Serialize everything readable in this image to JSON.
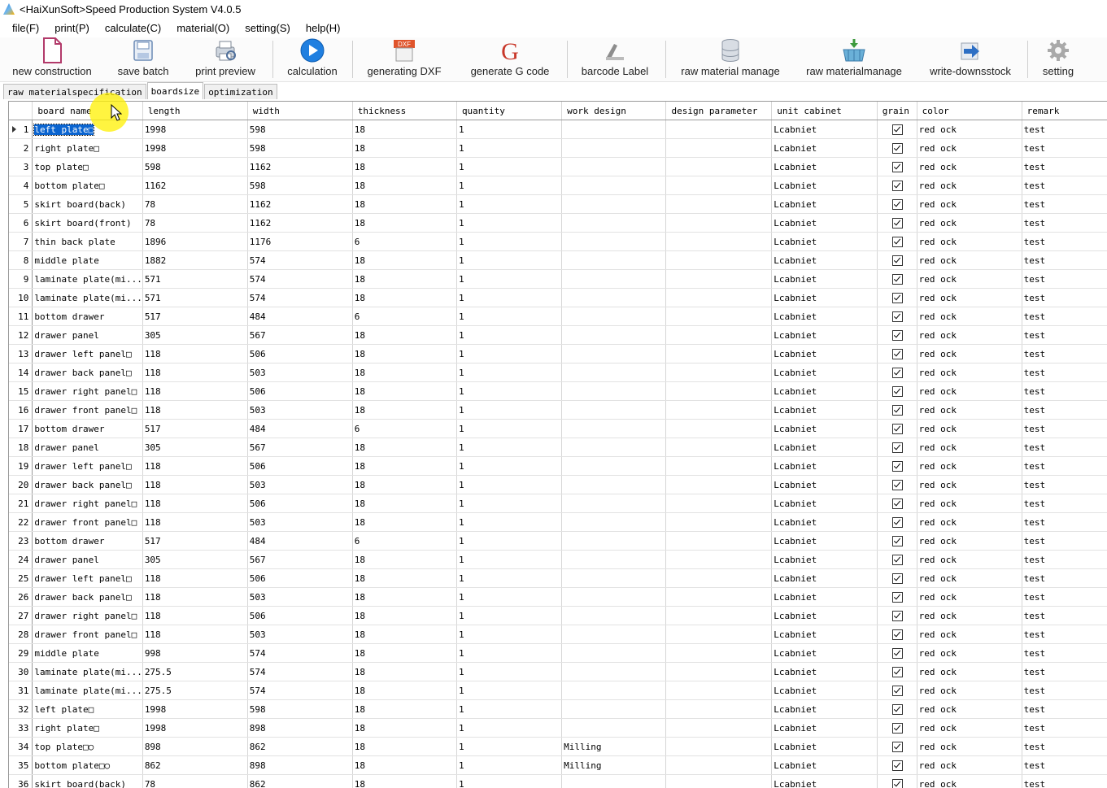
{
  "window": {
    "title": "<HaiXunSoft>Speed Production System V4.0.5"
  },
  "menu": [
    "file(F)",
    "print(P)",
    "calculate(C)",
    "material(O)",
    "setting(S)",
    "help(H)"
  ],
  "toolbar": [
    {
      "label": "new construction",
      "icon": "document-icon"
    },
    {
      "label": "save batch",
      "icon": "save-icon"
    },
    {
      "label": "print preview",
      "icon": "print-preview-icon"
    },
    {
      "label": "calculation",
      "icon": "play-icon"
    },
    {
      "label": "generating DXF",
      "icon": "dxf-icon"
    },
    {
      "label": "generate G code",
      "icon": "g-code-icon"
    },
    {
      "label": "barcode Label",
      "icon": "barcode-icon"
    },
    {
      "label": "raw material manage",
      "icon": "database-icon"
    },
    {
      "label": "raw materialmanage",
      "icon": "basket-icon"
    },
    {
      "label": "write-downsstock",
      "icon": "arrow-right-icon"
    },
    {
      "label": "setting",
      "icon": "gear-icon"
    }
  ],
  "tabs": [
    "raw materialspecification",
    "boardsize",
    "optimization"
  ],
  "active_tab": 1,
  "columns": [
    "board name",
    "length",
    "width",
    "thickness",
    "quantity",
    "work design",
    "design parameter",
    "unit cabinet",
    "grain",
    "color",
    "remark"
  ],
  "rows": [
    [
      "1",
      "left plate□",
      "1998",
      "598",
      "18",
      "1",
      "",
      "",
      "Lcabniet",
      "✓",
      "red ock",
      "test"
    ],
    [
      "2",
      "right plate□",
      "1998",
      "598",
      "18",
      "1",
      "",
      "",
      "Lcabniet",
      "✓",
      "red ock",
      "test"
    ],
    [
      "3",
      "top plate□",
      "598",
      "1162",
      "18",
      "1",
      "",
      "",
      "Lcabniet",
      "✓",
      "red ock",
      "test"
    ],
    [
      "4",
      "bottom plate□",
      "1162",
      "598",
      "18",
      "1",
      "",
      "",
      "Lcabniet",
      "✓",
      "red ock",
      "test"
    ],
    [
      "5",
      "skirt board(back)",
      "78",
      "1162",
      "18",
      "1",
      "",
      "",
      "Lcabniet",
      "✓",
      "red ock",
      "test"
    ],
    [
      "6",
      "skirt board(front)",
      "78",
      "1162",
      "18",
      "1",
      "",
      "",
      "Lcabniet",
      "✓",
      "red ock",
      "test"
    ],
    [
      "7",
      "thin back plate",
      "1896",
      "1176",
      "6",
      "1",
      "",
      "",
      "Lcabniet",
      "✓",
      "red ock",
      "test"
    ],
    [
      "8",
      "middle plate",
      "1882",
      "574",
      "18",
      "1",
      "",
      "",
      "Lcabniet",
      "✓",
      "red ock",
      "test"
    ],
    [
      "9",
      "laminate plate(mi...",
      "571",
      "574",
      "18",
      "1",
      "",
      "",
      "Lcabniet",
      "✓",
      "red ock",
      "test"
    ],
    [
      "10",
      "laminate plate(mi...",
      "571",
      "574",
      "18",
      "1",
      "",
      "",
      "Lcabniet",
      "✓",
      "red ock",
      "test"
    ],
    [
      "11",
      "bottom drawer",
      "517",
      "484",
      "6",
      "1",
      "",
      "",
      "Lcabniet",
      "✓",
      "red ock",
      "test"
    ],
    [
      "12",
      "drawer panel",
      "305",
      "567",
      "18",
      "1",
      "",
      "",
      "Lcabniet",
      "✓",
      "red ock",
      "test"
    ],
    [
      "13",
      "drawer left panel□",
      "118",
      "506",
      "18",
      "1",
      "",
      "",
      "Lcabniet",
      "✓",
      "red ock",
      "test"
    ],
    [
      "14",
      "drawer back panel□",
      "118",
      "503",
      "18",
      "1",
      "",
      "",
      "Lcabniet",
      "✓",
      "red ock",
      "test"
    ],
    [
      "15",
      "drawer right panel□",
      "118",
      "506",
      "18",
      "1",
      "",
      "",
      "Lcabniet",
      "✓",
      "red ock",
      "test"
    ],
    [
      "16",
      "drawer front panel□",
      "118",
      "503",
      "18",
      "1",
      "",
      "",
      "Lcabniet",
      "✓",
      "red ock",
      "test"
    ],
    [
      "17",
      "bottom drawer",
      "517",
      "484",
      "6",
      "1",
      "",
      "",
      "Lcabniet",
      "✓",
      "red ock",
      "test"
    ],
    [
      "18",
      "drawer panel",
      "305",
      "567",
      "18",
      "1",
      "",
      "",
      "Lcabniet",
      "✓",
      "red ock",
      "test"
    ],
    [
      "19",
      "drawer left panel□",
      "118",
      "506",
      "18",
      "1",
      "",
      "",
      "Lcabniet",
      "✓",
      "red ock",
      "test"
    ],
    [
      "20",
      "drawer back panel□",
      "118",
      "503",
      "18",
      "1",
      "",
      "",
      "Lcabniet",
      "✓",
      "red ock",
      "test"
    ],
    [
      "21",
      "drawer right panel□",
      "118",
      "506",
      "18",
      "1",
      "",
      "",
      "Lcabniet",
      "✓",
      "red ock",
      "test"
    ],
    [
      "22",
      "drawer front panel□",
      "118",
      "503",
      "18",
      "1",
      "",
      "",
      "Lcabniet",
      "✓",
      "red ock",
      "test"
    ],
    [
      "23",
      "bottom drawer",
      "517",
      "484",
      "6",
      "1",
      "",
      "",
      "Lcabniet",
      "✓",
      "red ock",
      "test"
    ],
    [
      "24",
      "drawer panel",
      "305",
      "567",
      "18",
      "1",
      "",
      "",
      "Lcabniet",
      "✓",
      "red ock",
      "test"
    ],
    [
      "25",
      "drawer left panel□",
      "118",
      "506",
      "18",
      "1",
      "",
      "",
      "Lcabniet",
      "✓",
      "red ock",
      "test"
    ],
    [
      "26",
      "drawer back panel□",
      "118",
      "503",
      "18",
      "1",
      "",
      "",
      "Lcabniet",
      "✓",
      "red ock",
      "test"
    ],
    [
      "27",
      "drawer right panel□",
      "118",
      "506",
      "18",
      "1",
      "",
      "",
      "Lcabniet",
      "✓",
      "red ock",
      "test"
    ],
    [
      "28",
      "drawer front panel□",
      "118",
      "503",
      "18",
      "1",
      "",
      "",
      "Lcabniet",
      "✓",
      "red ock",
      "test"
    ],
    [
      "29",
      "middle plate",
      "998",
      "574",
      "18",
      "1",
      "",
      "",
      "Lcabniet",
      "✓",
      "red ock",
      "test"
    ],
    [
      "30",
      "laminate plate(mi...",
      "275.5",
      "574",
      "18",
      "1",
      "",
      "",
      "Lcabniet",
      "✓",
      "red ock",
      "test"
    ],
    [
      "31",
      "laminate plate(mi...",
      "275.5",
      "574",
      "18",
      "1",
      "",
      "",
      "Lcabniet",
      "✓",
      "red ock",
      "test"
    ],
    [
      "32",
      "left plate□",
      "1998",
      "598",
      "18",
      "1",
      "",
      "",
      "Lcabniet",
      "✓",
      "red ock",
      "test"
    ],
    [
      "33",
      "right plate□",
      "1998",
      "898",
      "18",
      "1",
      "",
      "",
      "Lcabniet",
      "✓",
      "red ock",
      "test"
    ],
    [
      "34",
      "top plate□○",
      "898",
      "862",
      "18",
      "1",
      "Milling",
      "",
      "Lcabniet",
      "✓",
      "red ock",
      "test"
    ],
    [
      "35",
      "bottom plate□○",
      "862",
      "898",
      "18",
      "1",
      "Milling",
      "",
      "Lcabniet",
      "✓",
      "red ock",
      "test"
    ],
    [
      "36",
      "skirt board(back)",
      "78",
      "862",
      "18",
      "1",
      "",
      "",
      "Lcabniet",
      "✓",
      "red ock",
      "test"
    ]
  ],
  "selected_row": 0
}
